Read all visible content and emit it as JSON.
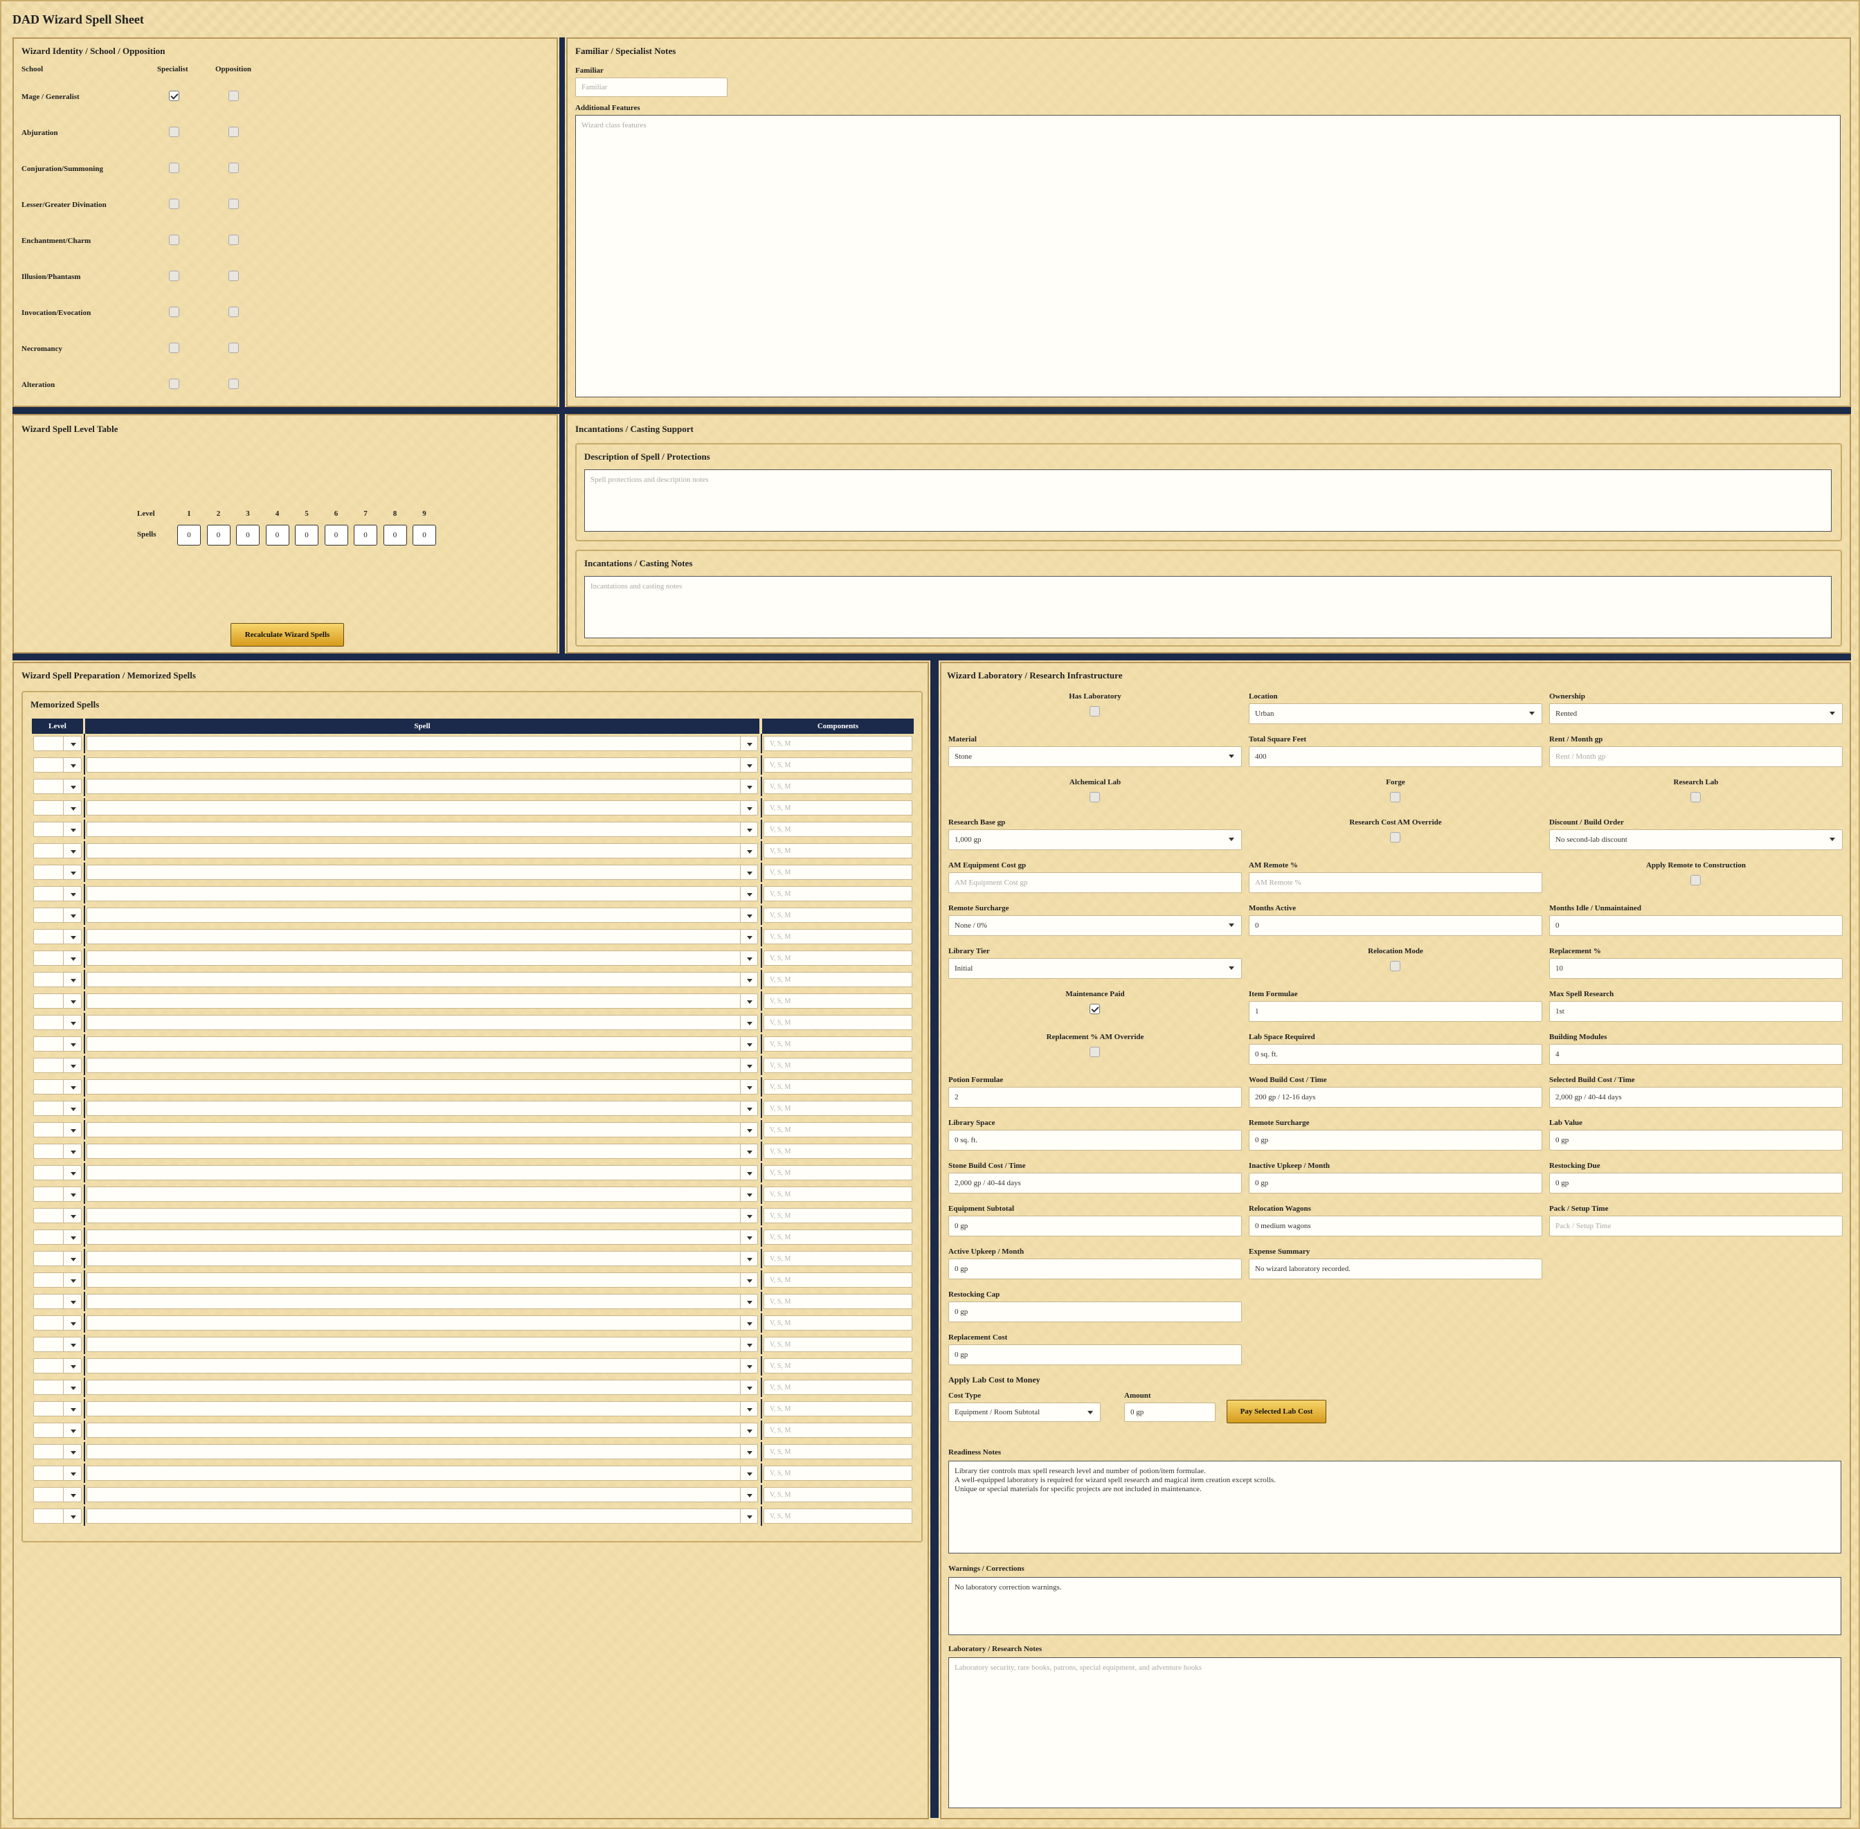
{
  "app_title": "DAD Wizard Spell Sheet",
  "identity": {
    "title": "Wizard Identity / School / Opposition",
    "col_school": "School",
    "col_specialist": "Specialist",
    "col_opposition": "Opposition",
    "schools": [
      {
        "name": "Mage / Generalist",
        "specialist": true,
        "opposition": false
      },
      {
        "name": "Abjuration",
        "specialist": false,
        "opposition": false
      },
      {
        "name": "Conjuration/Summoning",
        "specialist": false,
        "opposition": false
      },
      {
        "name": "Lesser/Greater Divination",
        "specialist": false,
        "opposition": false
      },
      {
        "name": "Enchantment/Charm",
        "specialist": false,
        "opposition": false
      },
      {
        "name": "Illusion/Phantasm",
        "specialist": false,
        "opposition": false
      },
      {
        "name": "Invocation/Evocation",
        "specialist": false,
        "opposition": false
      },
      {
        "name": "Necromancy",
        "specialist": false,
        "opposition": false
      },
      {
        "name": "Alteration",
        "specialist": false,
        "opposition": false
      }
    ]
  },
  "familiar": {
    "title": "Familiar / Specialist Notes",
    "familiar_label": "Familiar",
    "familiar_placeholder": "Familiar",
    "features_label": "Additional Features",
    "features_placeholder": "Wizard class features"
  },
  "spell_level": {
    "title": "Wizard Spell Level Table",
    "level_label": "Level",
    "spells_label": "Spells",
    "levels": [
      "1",
      "2",
      "3",
      "4",
      "5",
      "6",
      "7",
      "8",
      "9"
    ],
    "values": [
      "0",
      "0",
      "0",
      "0",
      "0",
      "0",
      "0",
      "0",
      "0"
    ],
    "button": "Recalculate Wizard Spells"
  },
  "incantations": {
    "title": "Incantations / Casting Support",
    "desc_title": "Description of Spell / Protections",
    "desc_placeholder": "Spell protections and description notes",
    "notes_title": "Incantations / Casting Notes",
    "notes_placeholder": "Incantations and casting notes"
  },
  "memorized": {
    "title": "Wizard Spell Preparation / Memorized Spells",
    "subtitle": "Memorized Spells",
    "col_level": "Level",
    "col_spell": "Spell",
    "col_components": "Components",
    "components_placeholder": "V, S, M",
    "row_count": 37
  },
  "lab": {
    "title": "Wizard Laboratory / Research Infrastructure",
    "has_lab_label": "Has Laboratory",
    "has_lab": false,
    "location_label": "Location",
    "location": "Urban",
    "ownership_label": "Ownership",
    "ownership": "Rented",
    "material_label": "Material",
    "material": "Stone",
    "sqft_label": "Total Square Feet",
    "sqft": "400",
    "rent_label": "Rent / Month gp",
    "rent_placeholder": "Rent / Month gp",
    "alch_label": "Alchemical Lab",
    "forge_label": "Forge",
    "research_lab_label": "Research Lab",
    "research_base_label": "Research Base gp",
    "research_base": "1,000 gp",
    "am_override_label": "Research Cost AM Override",
    "discount_label": "Discount / Build Order",
    "discount": "No second-lab discount",
    "am_equip_label": "AM Equipment Cost gp",
    "am_equip_placeholder": "AM Equipment Cost gp",
    "am_remote_label": "AM Remote %",
    "am_remote_placeholder": "AM Remote %",
    "apply_remote_label": "Apply Remote to Construction",
    "remote_surcharge_label": "Remote Surcharge",
    "remote_surcharge": "None / 0%",
    "months_active_label": "Months Active",
    "months_active": "0",
    "months_idle_label": "Months Idle / Unmaintained",
    "months_idle": "0",
    "library_tier_label": "Library Tier",
    "library_tier": "Initial",
    "relocation_mode_label": "Relocation Mode",
    "replacement_pct_label": "Replacement %",
    "replacement_pct": "10",
    "maint_paid_label": "Maintenance Paid",
    "maint_paid": true,
    "item_formulae_label": "Item Formulae",
    "item_formulae": "1",
    "max_spell_label": "Max Spell Research",
    "max_spell": "1st",
    "repl_am_label": "Replacement % AM Override",
    "lab_space_label": "Lab Space Required",
    "lab_space": "0 sq. ft.",
    "modules_label": "Building Modules",
    "modules": "4",
    "potion_label": "Potion Formulae",
    "potion": "2",
    "wood_label": "Wood Build Cost / Time",
    "wood": "200 gp / 12-16 days",
    "selected_build_label": "Selected Build Cost / Time",
    "selected_build": "2,000 gp / 40-44 days",
    "library_space_label": "Library Space",
    "library_space": "0 sq. ft.",
    "remote_sur2_label": "Remote Surcharge",
    "remote_sur2": "0 gp",
    "lab_value_label": "Lab Value",
    "lab_value": "0 gp",
    "stone_label": "Stone Build Cost / Time",
    "stone": "2,000 gp / 40-44 days",
    "inactive_label": "Inactive Upkeep / Month",
    "inactive": "0 gp",
    "restock_due_label": "Restocking Due",
    "restock_due": "0 gp",
    "equip_sub_label": "Equipment Subtotal",
    "equip_sub": "0 gp",
    "wagons_label": "Relocation Wagons",
    "wagons": "0 medium wagons",
    "pack_label": "Pack / Setup Time",
    "pack_placeholder": "Pack / Setup Time",
    "active_upkeep_label": "Active Upkeep / Month",
    "active_upkeep": "0 gp",
    "expense_label": "Expense Summary",
    "expense": "No wizard laboratory recorded.",
    "restock_cap_label": "Restocking Cap",
    "restock_cap": "0 gp",
    "repl_cost_label": "Replacement Cost",
    "repl_cost": "0 gp",
    "apply_title": "Apply Lab Cost to Money",
    "cost_type_label": "Cost Type",
    "cost_type": "Equipment / Room Subtotal",
    "amount_label": "Amount",
    "amount": "0 gp",
    "pay_button": "Pay Selected Lab Cost",
    "readiness_label": "Readiness Notes",
    "readiness": [
      "Library tier controls max spell research level and number of potion/item formulae.",
      "A well-equipped laboratory is required for wizard spell research and magical item creation except scrolls.",
      "Unique or special materials for specific projects are not included in maintenance."
    ],
    "warnings_label": "Warnings / Corrections",
    "warnings": "No laboratory correction warnings.",
    "research_notes_label": "Laboratory / Research Notes",
    "research_notes_placeholder": "Laboratory security, rare books, patrons, special equipment, and adventure hooks"
  }
}
